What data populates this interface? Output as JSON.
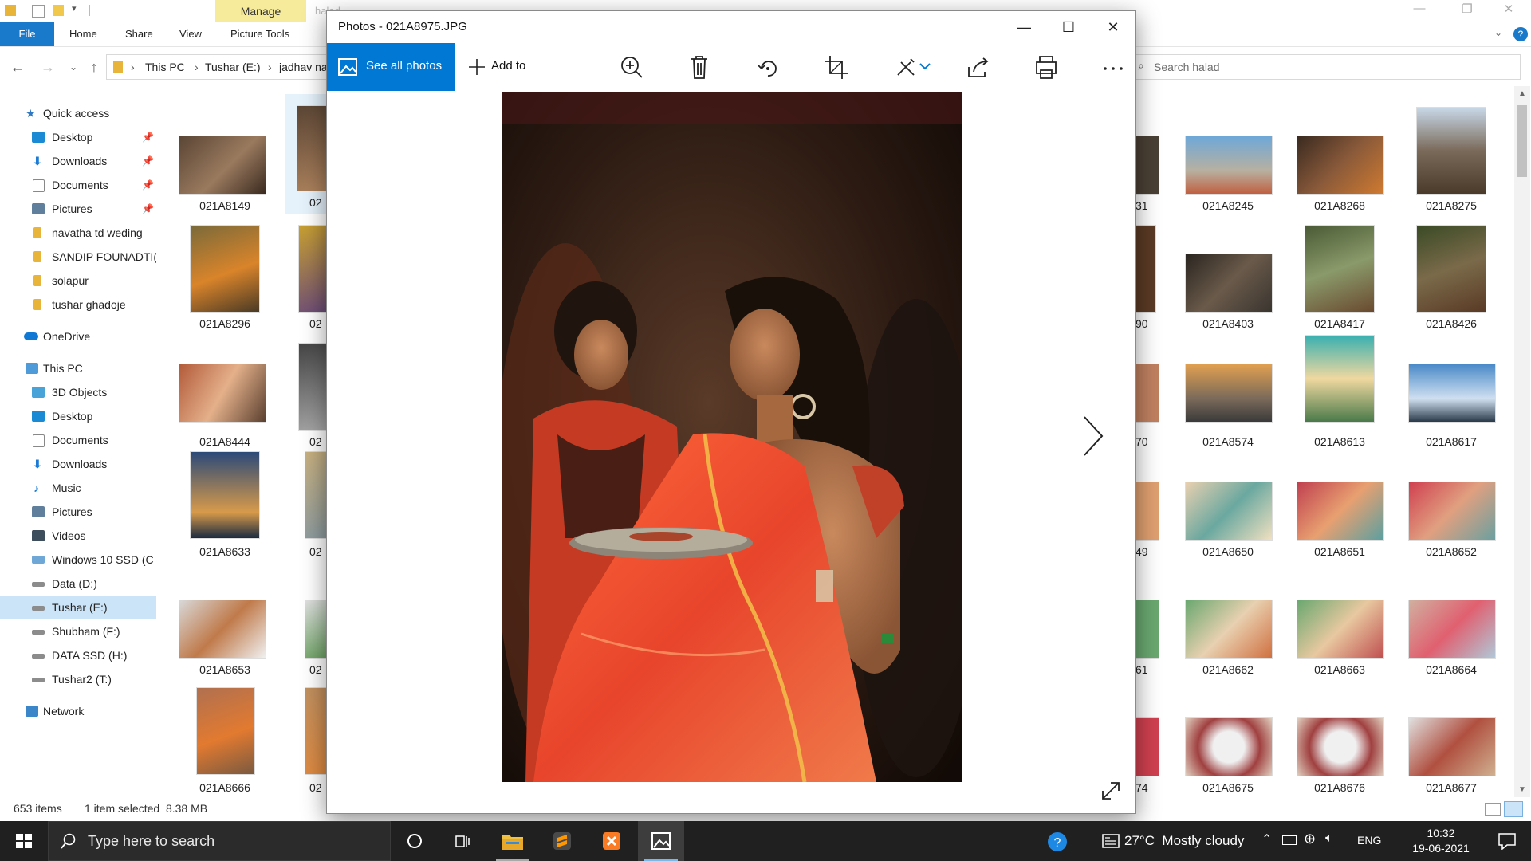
{
  "explorer": {
    "qat_faded_title": "halad",
    "ribbon": {
      "file_tab": "File",
      "tabs": [
        "Home",
        "Share",
        "View",
        "Picture Tools"
      ],
      "manage_tab": "Manage"
    },
    "breadcrumbs": [
      "This PC",
      "Tushar (E:)",
      "jadhav na"
    ],
    "search_placeholder": "Search halad",
    "nav": {
      "quick_access": "Quick access",
      "quick_items": [
        "Desktop",
        "Downloads",
        "Documents",
        "Pictures",
        "navatha td weding",
        "SANDIP FOUNADTI(",
        "solapur",
        "tushar ghadoje"
      ],
      "onedrive": "OneDrive",
      "this_pc": "This PC",
      "pc_items": [
        "3D Objects",
        "Desktop",
        "Documents",
        "Downloads",
        "Music",
        "Pictures",
        "Videos",
        "Windows 10 SSD (C",
        "Data (D:)",
        "Tushar (E:)",
        "Shubham (F:)",
        "DATA SSD (H:)",
        "Tushar2 (T:)"
      ],
      "network": "Network",
      "selected": "Tushar (E:)"
    },
    "thumbs_left": [
      "021A8149",
      "021A8296",
      "021A8444",
      "021A8633",
      "021A8653",
      "021A8666"
    ],
    "thumbs_col2": [
      "02",
      "02",
      "02",
      "02",
      "02",
      "02"
    ],
    "thumbs_partial": [
      "31",
      "90",
      "70",
      "49",
      "61",
      "74"
    ],
    "thumbs_right": [
      [
        "021A8245",
        "021A8268",
        "021A8275"
      ],
      [
        "021A8403",
        "021A8417",
        "021A8426"
      ],
      [
        "021A8574",
        "021A8613",
        "021A8617"
      ],
      [
        "021A8650",
        "021A8651",
        "021A8652"
      ],
      [
        "021A8662",
        "021A8663",
        "021A8664"
      ],
      [
        "021A8675",
        "021A8676",
        "021A8677"
      ]
    ],
    "status": {
      "item_count": "653 items",
      "selection": "1 item selected  8.38 MB"
    }
  },
  "photos": {
    "title": "Photos - 021A8975.JPG",
    "see_all": "See all photos",
    "add_to": "Add to",
    "toolbar_icons": [
      "zoom-icon",
      "delete-icon",
      "rotate-icon",
      "crop-icon",
      "edit-icon",
      "share-icon",
      "print-icon",
      "more-icon"
    ]
  },
  "taskbar": {
    "search_placeholder": "Type here to search",
    "weather": "27°C  Mostly cloudy",
    "language": "ENG",
    "time": "10:32",
    "date": "19-06-2021"
  },
  "colors": {
    "accent": "#0078d4",
    "file_tab": "#1979ca",
    "manage_tab": "#f6eb9a",
    "taskbar": "#202020"
  }
}
